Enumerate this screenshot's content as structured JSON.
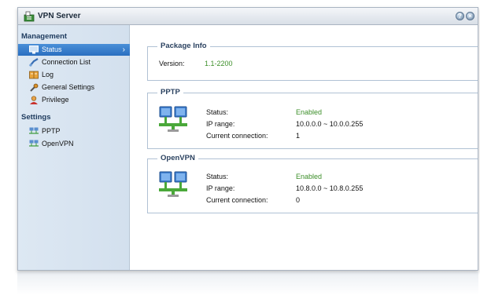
{
  "window": {
    "title": "VPN Server",
    "help_label": "?",
    "close_label": "×"
  },
  "sidebar": {
    "management_heading": "Management",
    "settings_heading": "Settings",
    "management_items": [
      {
        "label": "Status",
        "icon": "monitor-icon",
        "active": true
      },
      {
        "label": "Connection List",
        "icon": "connection-icon"
      },
      {
        "label": "Log",
        "icon": "log-icon"
      },
      {
        "label": "General Settings",
        "icon": "wrench-icon"
      },
      {
        "label": "Privilege",
        "icon": "user-icon"
      }
    ],
    "settings_items": [
      {
        "label": "PPTP",
        "icon": "network-icon"
      },
      {
        "label": "OpenVPN",
        "icon": "network-icon"
      }
    ],
    "active_chevron": "›"
  },
  "package_info": {
    "heading": "Package Info",
    "version_label": "Version:",
    "version_value": "1.1-2200"
  },
  "pptp": {
    "heading": "PPTP",
    "status_label": "Status:",
    "status_value": "Enabled",
    "ip_label": "IP range:",
    "ip_value": "10.0.0.0 ~ 10.0.0.255",
    "conn_label": "Current connection:",
    "conn_value": "1"
  },
  "openvpn": {
    "heading": "OpenVPN",
    "status_label": "Status:",
    "status_value": "Enabled",
    "ip_label": "IP range:",
    "ip_value": "10.8.0.0 ~ 10.8.0.255",
    "conn_label": "Current connection:",
    "conn_value": "0"
  },
  "colors": {
    "accent": "#2a6fc0",
    "enabled": "#3d8f2a",
    "sidebar_bg": "#d8e4f1"
  }
}
